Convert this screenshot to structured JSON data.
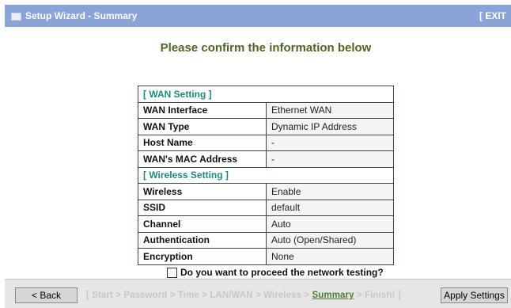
{
  "window": {
    "title": "Setup Wizard - Summary",
    "exit_label": "[ EXIT"
  },
  "main": {
    "heading": "Please confirm the information below",
    "wan_section": "[ WAN Setting ]",
    "wan_rows": [
      {
        "label": "WAN Interface",
        "value": "Ethernet WAN"
      },
      {
        "label": "WAN Type",
        "value": "Dynamic IP Address"
      },
      {
        "label": "Host Name",
        "value": "-"
      },
      {
        "label": "WAN's MAC Address",
        "value": "-"
      }
    ],
    "wireless_section": "[ Wireless Setting ]",
    "wireless_rows": [
      {
        "label": "Wireless",
        "value": "Enable"
      },
      {
        "label": "SSID",
        "value": "default"
      },
      {
        "label": "Channel",
        "value": "Auto"
      },
      {
        "label": "Authentication",
        "value": "Auto (Open/Shared)"
      },
      {
        "label": "Encryption",
        "value": "None"
      }
    ],
    "test_question": "Do you want to proceed the network testing?",
    "test_checked": false
  },
  "footer": {
    "back_label": "< Back",
    "apply_label": "Apply Settings",
    "steps_prefix": "[ Start > Password > Time > LAN/WAN > Wireless > ",
    "steps_current": "Summary",
    "steps_suffix": " > Finish! ]"
  },
  "colors": {
    "titlebar": "#8aa4d8",
    "heading": "#4d6626",
    "section": "#1c8a7c",
    "current_step": "#507a30"
  },
  "icons": {
    "title_icon": "window-icon"
  }
}
